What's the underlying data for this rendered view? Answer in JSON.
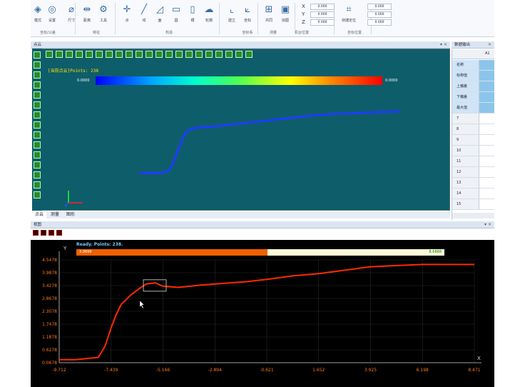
{
  "ribbon": {
    "buttons": [
      {
        "label": "模式",
        "x": 0
      },
      {
        "label": "设置",
        "x": 20
      },
      {
        "label": "尺寸",
        "x": 47
      },
      {
        "label": "距离",
        "x": 69
      },
      {
        "label": "工具",
        "x": 92
      },
      {
        "label": "点",
        "x": 125
      },
      {
        "label": "线",
        "x": 149
      },
      {
        "label": "面",
        "x": 171
      },
      {
        "label": "圆",
        "x": 194
      },
      {
        "label": "槽",
        "x": 217
      },
      {
        "label": "轮廓",
        "x": 240
      },
      {
        "label": "建立",
        "x": 272
      },
      {
        "label": "坐标",
        "x": 294
      },
      {
        "label": "共同",
        "x": 324
      },
      {
        "label": "拟图",
        "x": 347
      },
      {
        "label": "快捷定位",
        "x": 436
      }
    ],
    "groups": [
      "坐标/公差",
      "特征",
      "构造",
      "坐标系",
      "测量",
      "机台位置",
      "坐标位置"
    ],
    "coords": {
      "X": "0.000",
      "Y": "0.000",
      "Z": "0.000",
      "c2": [
        "0.000",
        "0.000",
        "0.000"
      ]
    }
  },
  "view3d": {
    "title": "点云",
    "label": "[当前点云]Points: 238",
    "cbar_min": "0.0000",
    "cbar_max": "0.0000",
    "tabs": [
      "点云",
      "测量",
      "图形"
    ]
  },
  "datapanel": {
    "title": "数据输出",
    "col": "A1",
    "rows": [
      "名称",
      "标称值",
      "上偏差",
      "下偏差",
      "最大值",
      "7",
      "8",
      "9",
      "10",
      "11",
      "12",
      "13",
      "14",
      "15"
    ]
  },
  "chart": {
    "panel_title": "视图",
    "status": "Ready. Points: 238.",
    "prog_left": "3.9698",
    "prog_right": "8.6888",
    "prog_fraction": 0.52,
    "ylabel": "Y",
    "xlabel": "X",
    "yticks": [
      "4.5478",
      "3.9878",
      "3.4278",
      "2.8678",
      "2.3078",
      "1.7478",
      "1.1878",
      "0.6278",
      "0.0678"
    ],
    "xticks": [
      "-9.712",
      "-7.439",
      "-5.166",
      "-2.894",
      "-0.621",
      "1.652",
      "3.925",
      "6.198",
      "8.471"
    ]
  },
  "chart_data": {
    "type": "line",
    "title": "",
    "xlabel": "X",
    "ylabel": "Y",
    "xlim": [
      -9.712,
      8.471
    ],
    "ylim": [
      0.0678,
      4.5478
    ],
    "x": [
      -9.712,
      -9.0,
      -8.5,
      -8.0,
      -7.7,
      -7.439,
      -7.2,
      -7.0,
      -6.6,
      -6.2,
      -5.9,
      -5.5,
      -5.166,
      -4.5,
      -3.5,
      -2.894,
      -1.5,
      -0.621,
      0.5,
      1.652,
      2.8,
      3.925,
      5.0,
      6.198,
      7.5,
      8.471
    ],
    "y": [
      0.2,
      0.2,
      0.25,
      0.3,
      0.8,
      1.6,
      2.2,
      2.6,
      3.0,
      3.3,
      3.5,
      3.55,
      3.4,
      3.35,
      3.45,
      3.5,
      3.6,
      3.7,
      3.85,
      3.95,
      4.1,
      4.25,
      4.3,
      4.35,
      4.35,
      4.35
    ],
    "series": [
      {
        "name": "",
        "color": "#ff2a00"
      }
    ]
  }
}
